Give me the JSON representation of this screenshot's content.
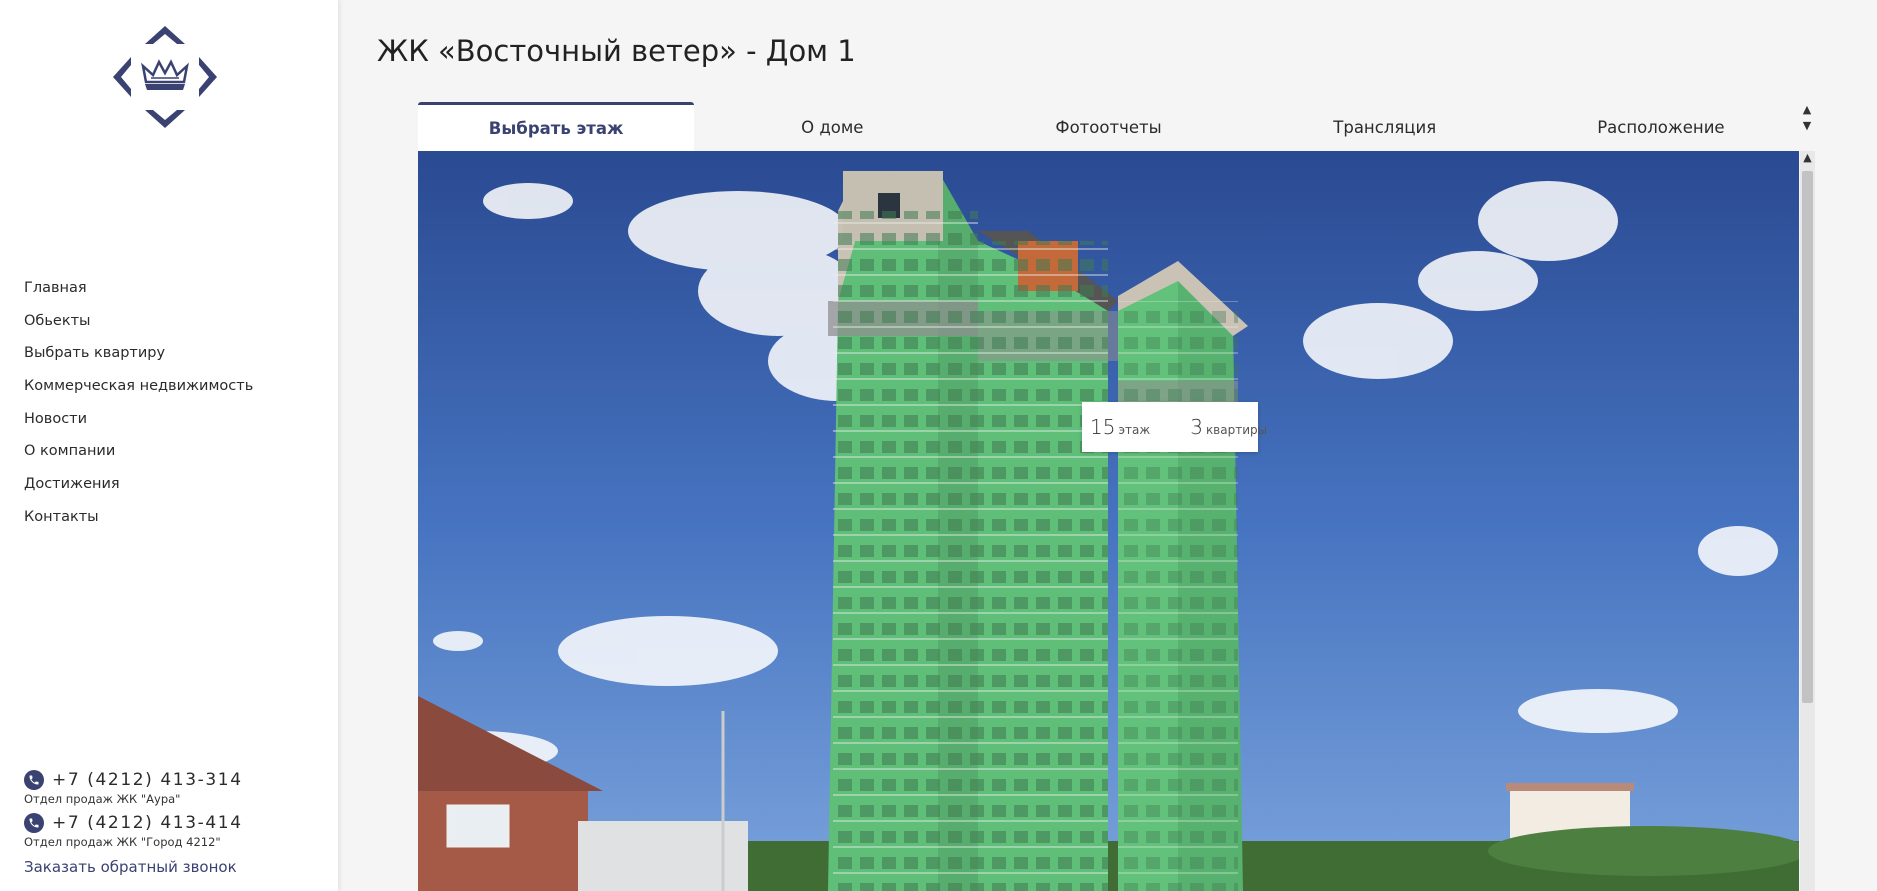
{
  "colors": {
    "brand": "#3a4272",
    "building_highlight": "#5fbf78"
  },
  "page": {
    "title": "ЖК «Восточный ветер» - Дом 1"
  },
  "nav": {
    "items": [
      {
        "label": "Главная"
      },
      {
        "label": "Обьекты"
      },
      {
        "label": "Выбрать квартиру"
      },
      {
        "label": "Коммерческая недвижимость"
      },
      {
        "label": "Новости"
      },
      {
        "label": "О компании"
      },
      {
        "label": "Достижения"
      },
      {
        "label": "Контакты"
      }
    ]
  },
  "contacts": {
    "phones": [
      {
        "number": "+7 (4212) 413-314",
        "caption": "Отдел продаж ЖК \"Аура\""
      },
      {
        "number": "+7 (4212) 413-414",
        "caption": "Отдел продаж ЖК \"Город 4212\""
      }
    ],
    "callback_label": "Заказать обратный звонок"
  },
  "tabs": [
    {
      "label": "Выбрать этаж",
      "active": true
    },
    {
      "label": "О доме"
    },
    {
      "label": "Фотоотчеты"
    },
    {
      "label": "Трансляция"
    },
    {
      "label": "Расположение"
    }
  ],
  "tooltip": {
    "floor_number": "15",
    "floor_unit": "этаж",
    "apartments_number": "3",
    "apartments_unit": "квартиры"
  },
  "icons": {
    "logo": "crown-diamond-logo",
    "phone": "phone-icon",
    "scroll_up": "chevron-up-icon",
    "scroll_down": "chevron-down-icon"
  }
}
